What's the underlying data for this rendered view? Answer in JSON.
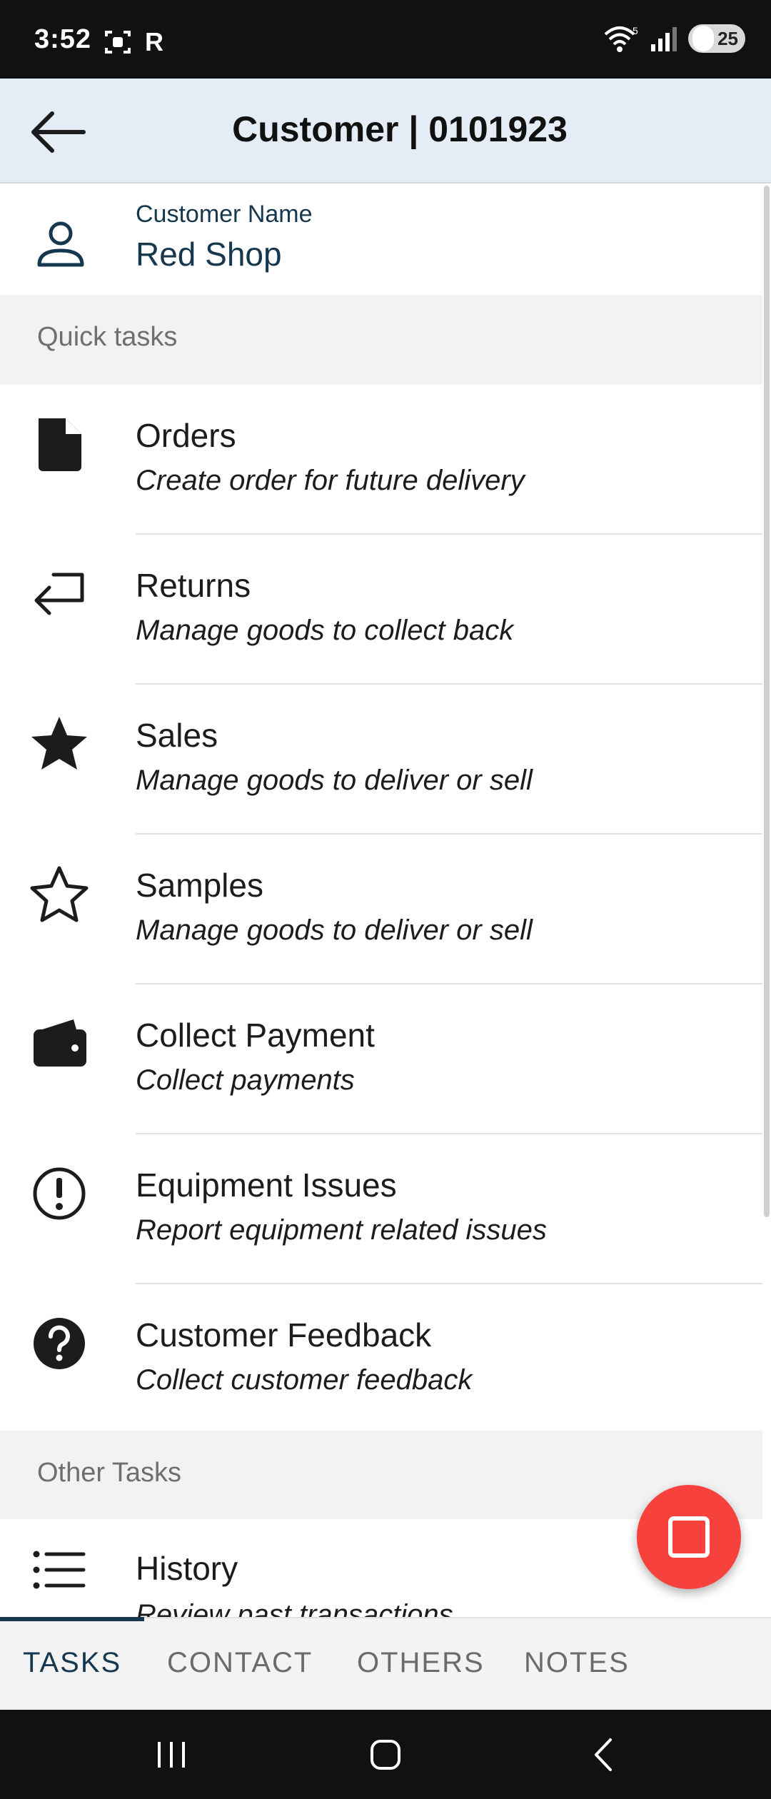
{
  "status_bar": {
    "time": "3:52",
    "carrier_badge": "R",
    "battery": "25",
    "wifi_badge": "5"
  },
  "app_bar": {
    "title": "Customer | 0101923"
  },
  "customer": {
    "label": "Customer Name",
    "value": "Red Shop"
  },
  "sections": {
    "quick_tasks": "Quick tasks",
    "other_tasks": "Other Tasks"
  },
  "quick_tasks": [
    {
      "title": "Orders",
      "subtitle": "Create order for future delivery",
      "icon": "file-icon"
    },
    {
      "title": "Returns",
      "subtitle": "Manage goods to collect back",
      "icon": "return-arrow-icon"
    },
    {
      "title": "Sales",
      "subtitle": "Manage goods to deliver or sell",
      "icon": "star-filled-icon"
    },
    {
      "title": "Samples",
      "subtitle": "Manage goods to deliver or sell",
      "icon": "star-outline-icon"
    },
    {
      "title": "Collect Payment",
      "subtitle": "Collect payments",
      "icon": "wallet-icon"
    },
    {
      "title": "Equipment Issues",
      "subtitle": "Report equipment related issues",
      "icon": "alert-circle-icon"
    },
    {
      "title": "Customer Feedback",
      "subtitle": "Collect customer feedback",
      "icon": "help-circle-icon"
    }
  ],
  "other_tasks": [
    {
      "title": "History",
      "subtitle": "Review past transactions",
      "icon": "list-icon"
    }
  ],
  "tabs": [
    {
      "label": "TASKS",
      "active": true
    },
    {
      "label": "CONTACT",
      "active": false
    },
    {
      "label": "OTHERS",
      "active": false
    },
    {
      "label": "NOTES",
      "active": false
    }
  ],
  "colors": {
    "app_bar": "#e4edf6",
    "accent": "#16384f",
    "fab": "#f6413c"
  }
}
